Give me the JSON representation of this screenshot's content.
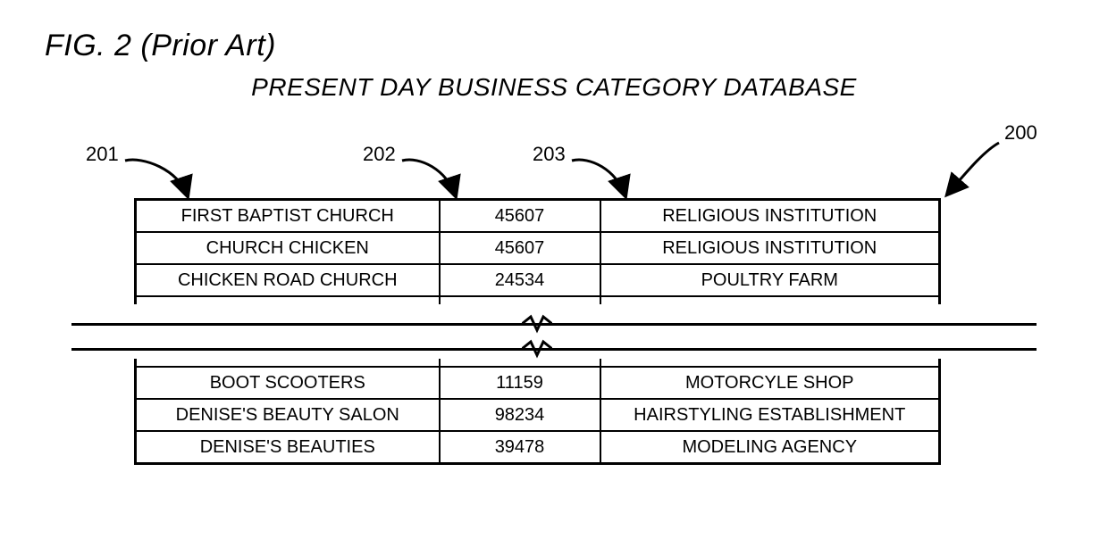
{
  "figure_label": "FIG. 2 (Prior Art)",
  "figure_title": "PRESENT DAY BUSINESS CATEGORY DATABASE",
  "refs": {
    "r200": "200",
    "r201": "201",
    "r202": "202",
    "r203": "203"
  },
  "chart_data": {
    "type": "table",
    "title": "PRESENT DAY BUSINESS CATEGORY DATABASE",
    "column_refs": [
      "201",
      "202",
      "203"
    ],
    "top_rows": [
      {
        "name": "FIRST BAPTIST CHURCH",
        "code": "45607",
        "category": "RELIGIOUS INSTITUTION"
      },
      {
        "name": "CHURCH CHICKEN",
        "code": "45607",
        "category": "RELIGIOUS INSTITUTION"
      },
      {
        "name": "CHICKEN ROAD CHURCH",
        "code": "24534",
        "category": "POULTRY FARM"
      }
    ],
    "bottom_rows": [
      {
        "name": "BOOT SCOOTERS",
        "code": "11159",
        "category": "MOTORCYLE SHOP"
      },
      {
        "name": "DENISE'S BEAUTY SALON",
        "code": "98234",
        "category": "HAIRSTYLING ESTABLISHMENT"
      },
      {
        "name": "DENISE'S BEAUTIES",
        "code": "39478",
        "category": "MODELING AGENCY"
      }
    ],
    "break": true
  }
}
